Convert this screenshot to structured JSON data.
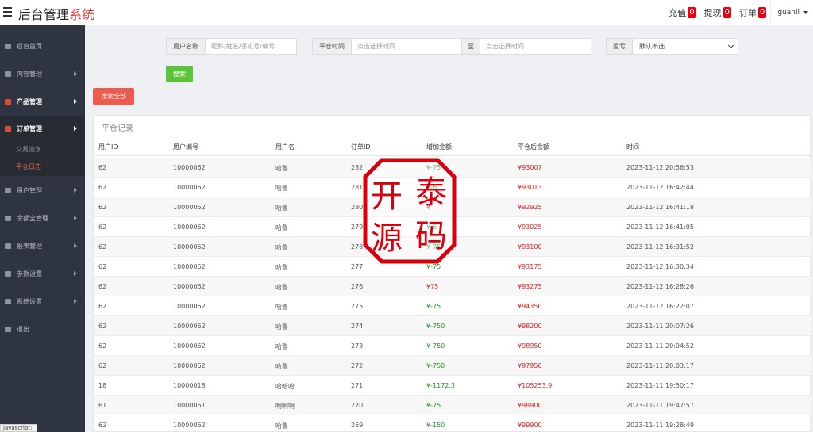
{
  "header": {
    "brand_main": "后台管理",
    "brand_accent": "系统",
    "recharge_label": "充值",
    "recharge_count": "0",
    "withdraw_label": "提现",
    "withdraw_count": "0",
    "order_label": "订单",
    "order_count": "0",
    "username": "guanli"
  },
  "sidebar": {
    "items": [
      {
        "label": "后台首页",
        "icon": "dashboard-icon"
      },
      {
        "label": "内容管理",
        "icon": "content-icon"
      },
      {
        "label": "产品管理",
        "icon": "bitcoin-icon"
      },
      {
        "label": "订单管理",
        "icon": "order-icon"
      },
      {
        "label": "用户管理",
        "icon": "user-icon"
      },
      {
        "label": "余额宝管理",
        "icon": "wallet-icon"
      },
      {
        "label": "报表管理",
        "icon": "report-icon"
      },
      {
        "label": "参数设置",
        "icon": "params-icon"
      },
      {
        "label": "系统设置",
        "icon": "gears-icon"
      },
      {
        "label": "退出",
        "icon": "logout-icon"
      }
    ],
    "submenu": [
      "交易流水",
      "平仓日志"
    ],
    "status_tip": "javascript:;"
  },
  "filters": {
    "user_label": "用户名称",
    "user_placeholder": "昵称/姓名/手机号/编号",
    "time_label": "平仓时间",
    "time_start_placeholder": "点击选择时间",
    "time_to": "至",
    "time_end_placeholder": "点击选择时间",
    "pnl_label": "盈亏",
    "pnl_selected": "默认不选",
    "search_button": "搜索",
    "search_all_button": "搜索全部"
  },
  "table": {
    "title": "平仓记录",
    "headers": [
      "用户ID",
      "用户编号",
      "用户名",
      "订单ID",
      "增加金额",
      "平仓后余额",
      "时间"
    ],
    "rows": [
      [
        "62",
        "10000062",
        "哈鲁",
        "282",
        "¥-75",
        "¥93007",
        "2023-11-12 20:56:53"
      ],
      [
        "62",
        "10000062",
        "哈鲁",
        "281",
        "¥-6",
        "¥93013",
        "2023-11-12 16:42:44"
      ],
      [
        "62",
        "10000062",
        "哈鲁",
        "280",
        "¥",
        "¥92925",
        "2023-11-12 16:41:18"
      ],
      [
        "62",
        "10000062",
        "哈鲁",
        "279",
        "¥-6",
        "¥93025",
        "2023-11-12 16:41:05"
      ],
      [
        "62",
        "10000062",
        "哈鲁",
        "278",
        "¥-75",
        "¥93100",
        "2023-11-12 16:31:52"
      ],
      [
        "62",
        "10000062",
        "哈鲁",
        "277",
        "¥-75",
        "¥93175",
        "2023-11-12 16:30:34"
      ],
      [
        "62",
        "10000062",
        "哈鲁",
        "276",
        "¥75",
        "¥93275",
        "2023-11-12 16:28:26"
      ],
      [
        "62",
        "10000062",
        "哈鲁",
        "275",
        "¥-75",
        "¥94350",
        "2023-11-12 16:22:07"
      ],
      [
        "62",
        "10000062",
        "哈鲁",
        "274",
        "¥-750",
        "¥98200",
        "2023-11-11 20:07:26"
      ],
      [
        "62",
        "10000062",
        "哈鲁",
        "273",
        "¥-750",
        "¥98950",
        "2023-11-11 20:04:52"
      ],
      [
        "62",
        "10000062",
        "哈鲁",
        "272",
        "¥-750",
        "¥97950",
        "2023-11-11 20:03:17"
      ],
      [
        "18",
        "10000018",
        "哈哈哈",
        "271",
        "¥-1172.3",
        "¥105253.9",
        "2023-11-11 19:50:17"
      ],
      [
        "61",
        "10000061",
        "啊啊啊",
        "270",
        "¥-75",
        "¥98900",
        "2023-11-11 19:47:57"
      ],
      [
        "62",
        "10000062",
        "哈鲁",
        "269",
        "¥-150",
        "¥99900",
        "2023-11-11 19:28:49"
      ]
    ]
  },
  "watermark": {
    "chars": [
      "开",
      "泰",
      "源",
      "码"
    ],
    "color": "#d9000d"
  }
}
